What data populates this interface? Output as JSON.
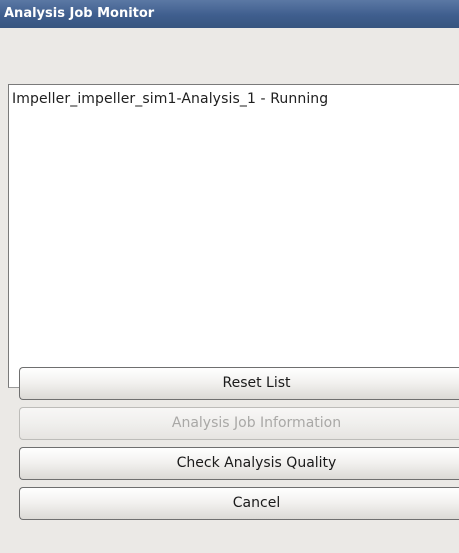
{
  "window": {
    "title": "Analysis Job Monitor"
  },
  "jobs": {
    "items": [
      {
        "label": "Impeller_impeller_sim1-Analysis_1 - Running"
      }
    ]
  },
  "buttons": {
    "reset_list": "Reset List",
    "job_information": "Analysis Job Information",
    "check_quality": "Check Analysis Quality",
    "cancel": "Cancel"
  },
  "colors": {
    "titlebar": "#3f5e8e",
    "background": "#ebe9e6"
  }
}
